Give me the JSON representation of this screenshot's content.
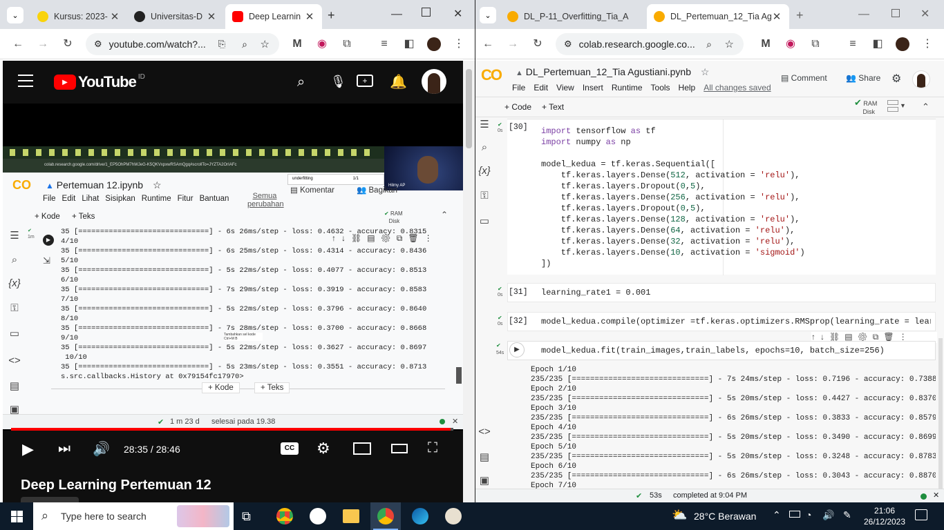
{
  "left_browser": {
    "tabs": [
      {
        "title": "Kursus: 2023-",
        "active": false
      },
      {
        "title": "Universitas-D",
        "active": false
      },
      {
        "title": "Deep Learnin",
        "active": true
      }
    ],
    "new_tab": "+",
    "url": "youtube.com/watch?...",
    "youtube": {
      "logo_text": "YouTube",
      "region": "ID",
      "video_title": "Deep Learning Pertemuan 12",
      "time": "28:35 / 28:46",
      "progress": 0.994,
      "inner_colab": {
        "url": "colab.research.google.com/drive/1_EP5OhPM7hWJeG-K5QKVxpxwRSAmQgq#scrollTo=JYZTA2OrIAFc",
        "find_text": "underfitting",
        "find_count": "1/1",
        "presenter": "Hilmy AP",
        "notebook": "Pertemuan 12.ipynb",
        "menu": [
          "File",
          "Edit",
          "Lihat",
          "Sisipkan",
          "Runtime",
          "Fitur",
          "Bantuan"
        ],
        "saved": "Semua perubahan",
        "comment": "Komentar",
        "share": "Bagikan",
        "add_code": "+ Kode",
        "add_text": "+ Teks",
        "ram": "RAM",
        "disk": "Disk",
        "cell_time": "1m",
        "output_lines": [
          "35 [==============================] - 6s 26ms/step - loss: 0.4632 - accuracy: 0.8315",
          "4/10",
          "35 [==============================] - 6s 25ms/step - loss: 0.4314 - accuracy: 0.8436",
          "5/10",
          "35 [==============================] - 5s 22ms/step - loss: 0.4077 - accuracy: 0.8513",
          "6/10",
          "35 [==============================] - 7s 29ms/step - loss: 0.3919 - accuracy: 0.8583",
          "7/10",
          "35 [==============================] - 5s 22ms/step - loss: 0.3796 - accuracy: 0.8640",
          "8/10",
          "35 [==============================] - 7s 28ms/step - loss: 0.3700 - accuracy: 0.8668",
          "9/10",
          "35 [==============================] - 5s 22ms/step - loss: 0.3627 - accuracy: 0.8697",
          " 10/10",
          "35 [==============================] - 5s 23ms/step - loss: 0.3551 - accuracy: 0.8713",
          "s.src.callbacks.History at 0x79154fc17970>"
        ],
        "tooltip": "Tambahkan sel kode Ctrl+M B",
        "status_time": "1 m 23 d",
        "status_text": "selesai pada 19.38"
      }
    }
  },
  "right_browser": {
    "tabs": [
      {
        "title": "DL_P-11_Overfitting_Tia_A",
        "active": false
      },
      {
        "title": "DL_Pertemuan_12_Tia Agu",
        "active": true
      }
    ],
    "new_tab": "+",
    "url": "colab.research.google.co...",
    "colab": {
      "notebook": "DL_Pertemuan_12_Tia Agustiani.pynb",
      "menu": [
        "File",
        "Edit",
        "View",
        "Insert",
        "Runtime",
        "Tools",
        "Help"
      ],
      "saved": "All changes saved",
      "comment": "Comment",
      "share": "Share",
      "add_code": "+ Code",
      "add_text": "+ Text",
      "ram": "RAM",
      "disk": "Disk",
      "cells": [
        {
          "num": "[30]",
          "time": "0s"
        },
        {
          "num": "[31]",
          "time": "0s",
          "code": "learning_rate1 = 0.001"
        },
        {
          "num": "[32]",
          "time": "0s",
          "code": "model_kedua.compile(optimizer =tf.keras.optimizers.RMSprop(learning_rate = learning_ra"
        },
        {
          "num": "",
          "time": "54s",
          "code": "model_kedua.fit(train_images,train_labels, epochs=10, batch_size=256)"
        }
      ],
      "cell30": [
        "import tensorflow as tf",
        "import numpy as np",
        "",
        "model_kedua = tf.keras.Sequential([",
        "    tf.keras.layers.Dense(512, activation = 'relu'),",
        "    tf.keras.layers.Dropout(0,5),",
        "    tf.keras.layers.Dense(256, activation = 'relu'),",
        "    tf.keras.layers.Dropout(0,5),",
        "    tf.keras.layers.Dense(128, activation = 'relu'),",
        "    tf.keras.layers.Dense(64, activation = 'relu'),",
        "    tf.keras.layers.Dense(32, activation = 'relu'),",
        "    tf.keras.layers.Dense(10, activation = 'sigmoid')",
        "])"
      ],
      "fit_output": [
        "Epoch 1/10",
        "235/235 [==============================] - 7s 24ms/step - loss: 0.7196 - accuracy: 0.7388",
        "Epoch 2/10",
        "235/235 [==============================] - 5s 20ms/step - loss: 0.4427 - accuracy: 0.8370",
        "Epoch 3/10",
        "235/235 [==============================] - 6s 26ms/step - loss: 0.3833 - accuracy: 0.8579",
        "Epoch 4/10",
        "235/235 [==============================] - 5s 20ms/step - loss: 0.3490 - accuracy: 0.8699",
        "Epoch 5/10",
        "235/235 [==============================] - 5s 20ms/step - loss: 0.3248 - accuracy: 0.8783",
        "Epoch 6/10",
        "235/235 [==============================] - 6s 26ms/step - loss: 0.3043 - accuracy: 0.8870",
        "Epoch 7/10"
      ],
      "status_time": "53s",
      "status_text": "completed at 9:04 PM"
    }
  },
  "taskbar": {
    "search_placeholder": "Type here to search",
    "weather": "28°C  Berawan",
    "clock_time": "21:06",
    "clock_date": "26/12/2023"
  },
  "colors": {
    "youtube_red": "#ff0000",
    "colab_orange": "#f9ab00",
    "taskbar": "#0d1b2a"
  }
}
